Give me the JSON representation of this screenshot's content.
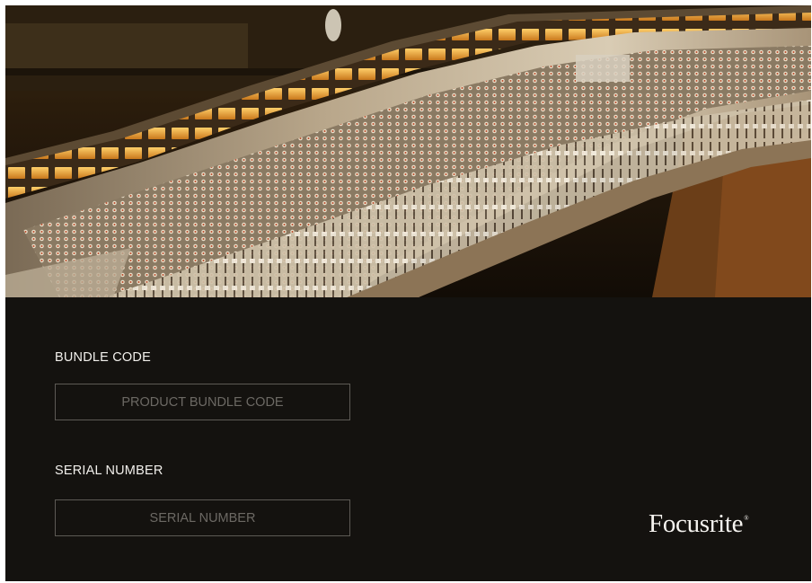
{
  "form": {
    "bundle_label": "BUNDLE CODE",
    "bundle_placeholder": "PRODUCT BUNDLE CODE",
    "bundle_value": "",
    "serial_label": "SERIAL NUMBER",
    "serial_placeholder": "SERIAL NUMBER",
    "serial_value": ""
  },
  "brand": {
    "logo_text": "Focusrite",
    "registered_mark": "®"
  },
  "colors": {
    "background": "#14120f",
    "text": "#f2f0ec",
    "field_border": "#5d5a55",
    "placeholder": "#6c6964"
  }
}
